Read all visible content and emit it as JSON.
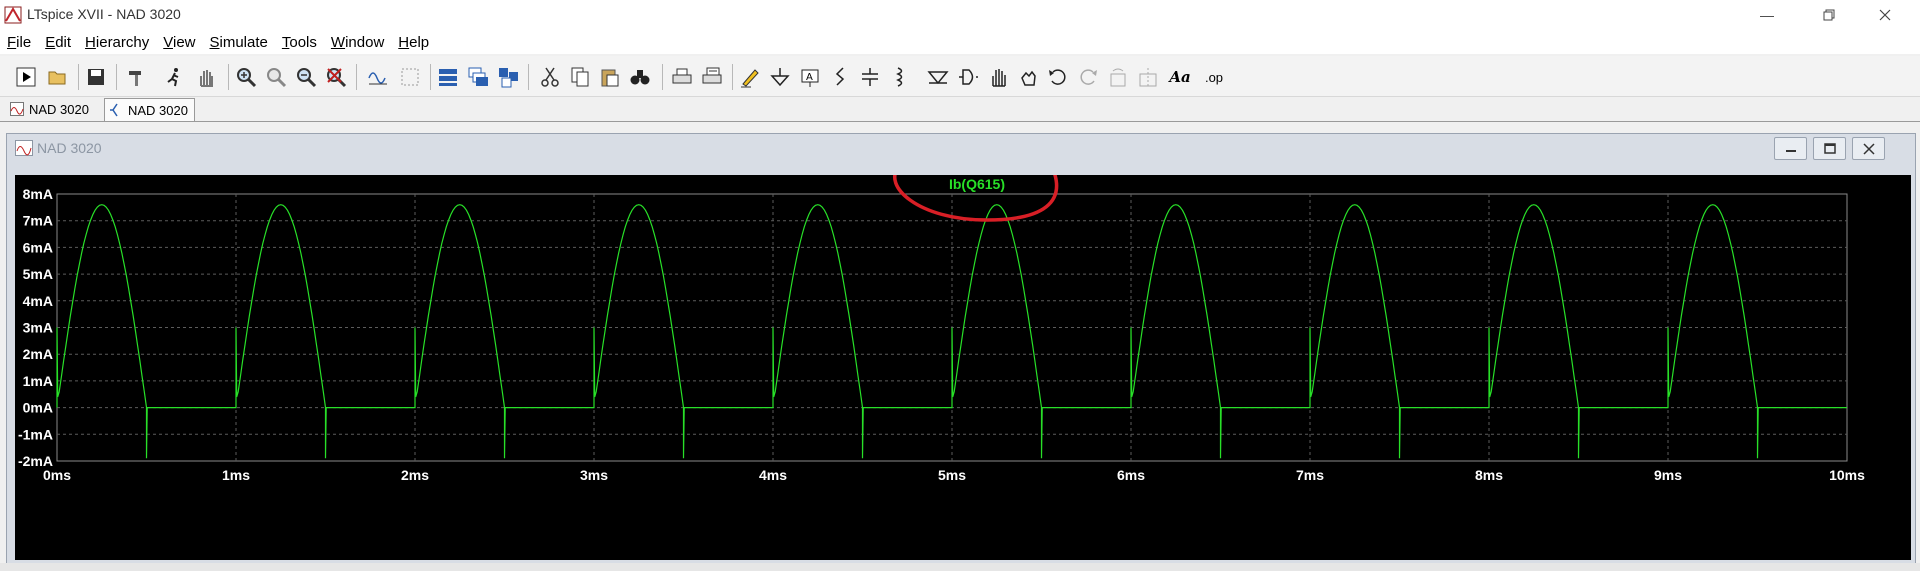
{
  "window": {
    "title": "LTspice XVII - NAD 3020"
  },
  "menu": [
    {
      "key": "F",
      "rest": "ile"
    },
    {
      "key": "E",
      "rest": "dit"
    },
    {
      "key": "H",
      "rest": "ierarchy"
    },
    {
      "key": "V",
      "rest": "iew"
    },
    {
      "key": "S",
      "rest": "imulate"
    },
    {
      "key": "T",
      "rest": "ools"
    },
    {
      "key": "W",
      "rest": "indow"
    },
    {
      "key": "H",
      "rest": "elp"
    }
  ],
  "toolbar": {
    "op_label": ".op",
    "text_label": "Aa"
  },
  "tabs": [
    {
      "label": "NAD 3020"
    },
    {
      "label": "NAD 3020"
    }
  ],
  "subwindow": {
    "title": "NAD 3020"
  },
  "colors": {
    "trace": "#28e028",
    "annotation": "#d81f26",
    "grid": "#5c5c5c",
    "axis_text": "#ffffff",
    "plot_bg": "#000000"
  },
  "chart_data": {
    "type": "line",
    "title": "",
    "series": [
      {
        "name": "Ib(Q615)"
      }
    ],
    "x_ticks": [
      "0ms",
      "1ms",
      "2ms",
      "3ms",
      "4ms",
      "5ms",
      "6ms",
      "7ms",
      "8ms",
      "9ms",
      "10ms"
    ],
    "y_ticks": [
      "8mA",
      "7mA",
      "6mA",
      "5mA",
      "4mA",
      "3mA",
      "2mA",
      "1mA",
      "0mA",
      "-1mA",
      "-2mA"
    ],
    "xlim": [
      0,
      10
    ],
    "ylim": [
      -2,
      8
    ],
    "x_unit": "ms",
    "y_unit": "mA",
    "grid": true,
    "waveform": {
      "period_ms": 1.0,
      "peak_mA": 7.6,
      "conduction_start_ms": 0.0,
      "conduction_end_ms": 0.5,
      "spike_on_mA": 3.0,
      "spike_off_mA": -1.9,
      "off_level_mA": 0.0
    }
  }
}
